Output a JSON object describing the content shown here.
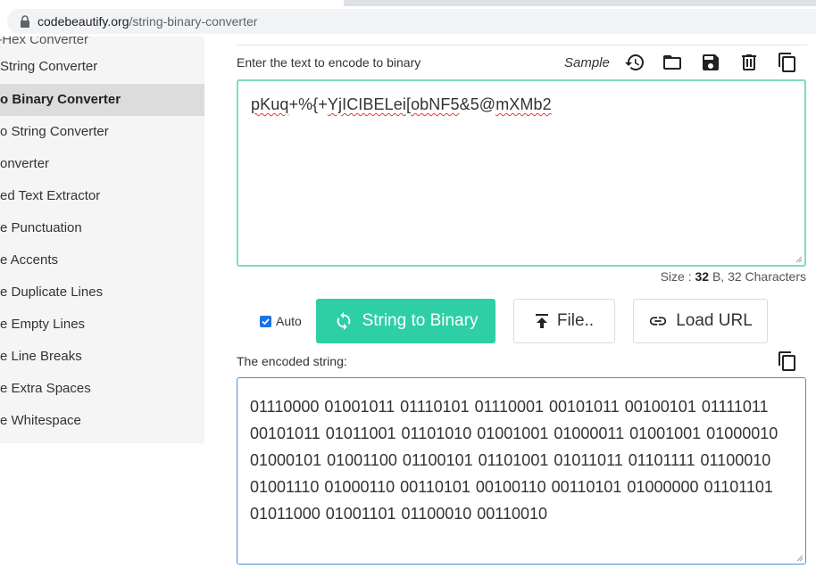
{
  "browser": {
    "url_domain": "codebeautify.org",
    "url_path": "/string-binary-converter"
  },
  "sidebar": {
    "top_partial": "e-Hex Converter",
    "items": [
      {
        "label": "String Converter",
        "active": false
      },
      {
        "label": "o Binary Converter",
        "active": true
      },
      {
        "label": "o String Converter",
        "active": false
      },
      {
        "label": "onverter",
        "active": false
      },
      {
        "label": "ed Text Extractor",
        "active": false
      },
      {
        "label": "e Punctuation",
        "active": false
      },
      {
        "label": "e Accents",
        "active": false
      },
      {
        "label": "e Duplicate Lines",
        "active": false
      },
      {
        "label": "e Empty Lines",
        "active": false
      },
      {
        "label": "e Line Breaks",
        "active": false
      },
      {
        "label": "e Extra Spaces",
        "active": false
      },
      {
        "label": "e Whitespace",
        "active": false
      }
    ]
  },
  "input": {
    "label": "Enter the text to encode to binary",
    "sample_label": "Sample",
    "value_parts": [
      "pKuq",
      "+%{+",
      "YjICIBELei",
      "[",
      "obNF5",
      "&5@",
      "mXMb2"
    ],
    "toolbar_icons": [
      "history-icon",
      "folder-open-icon",
      "save-icon",
      "delete-icon",
      "copy-icon"
    ]
  },
  "size_info": {
    "prefix": "Size : ",
    "bytes": "32",
    "suffix": " B, 32 Characters"
  },
  "controls": {
    "auto_label": "Auto",
    "auto_checked": true,
    "convert_label": "String to Binary",
    "file_label": "File..",
    "load_url_label": "Load URL"
  },
  "output": {
    "label": "The encoded string:",
    "value": "01110000 01001011 01110101 01110001 00101011 00100101 01111011 00101011 01011001 01101010 01001001 01000011 01001001 01000010 01000101 01001100 01100101 01101001 01011011 01101111 01100010 01001110 01000110 00110101 00100110 00110101 01000000 01101101 01011000 01001101 01100010 00110010"
  },
  "colors": {
    "accent": "#2ecfa5",
    "input_border": "#7bdcc2",
    "output_border": "#4a90d9",
    "active_item_bg": "#dcdcdc",
    "sidebar_bg": "#f5f5f5"
  }
}
